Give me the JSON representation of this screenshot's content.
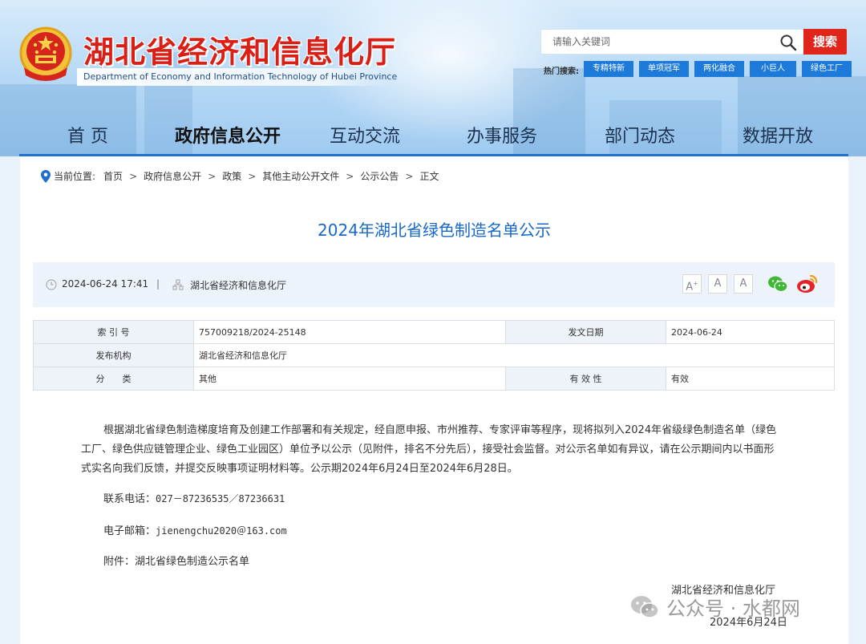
{
  "header": {
    "site_title": "湖北省经济和信息化厅",
    "site_subtitle": "Department of Economy and Information Technology of Hubei Province",
    "search": {
      "placeholder": "请输入关键词",
      "button_label": "搜索"
    },
    "hot_label": "热门搜索:",
    "hot_tags": [
      "专精特新",
      "单项冠军",
      "两化融合",
      "小巨人",
      "绿色工厂"
    ]
  },
  "nav": {
    "items": [
      "首 页",
      "政府信息公开",
      "互动交流",
      "办事服务",
      "部门动态",
      "数据开放"
    ],
    "active_index": 1
  },
  "breadcrumb": {
    "label": "当前位置:",
    "items": [
      "首页",
      "政府信息公开",
      "政策",
      "其他主动公开文件",
      "公示公告",
      "正文"
    ]
  },
  "article": {
    "title": "2024年湖北省绿色制造名单公示",
    "date": "2024-06-24 17:41",
    "divider": "|",
    "source": "湖北省经济和信息化厅",
    "font_sizes": [
      "A",
      "A",
      "A"
    ]
  },
  "info_table": {
    "rows": [
      {
        "k1": "索 引 号",
        "v1": "757009218/2024-25148",
        "k2": "发文日期",
        "v2": "2024-06-24"
      },
      {
        "k1": "发布机构",
        "v1": "湖北省经济和信息化厅"
      },
      {
        "k1": "分　　类",
        "v1": "其他",
        "k2": "有 效 性",
        "v2": "有效"
      }
    ]
  },
  "body": {
    "paragraph": "根据湖北省绿色制造梯度培育及创建工作部署和有关规定，经自愿申报、市州推荐、专家评审等程序，现将拟列入2024年省级绿色制造名单（绿色工厂、绿色供应链管理企业、绿色工业园区）单位予以公示（见附件，排名不分先后），接受社会监督。对公示名单如有异议，请在公示期间内以书面形式实名向我们反馈，并提交反映事项证明材料等。公示期2024年6月24日至2024年6月28日。",
    "phone_label": "联系电话：",
    "phone": "027－87236535／87236631",
    "email_label": "电子邮箱：",
    "email": "jienengchu2020＠163.com",
    "attachment_label": "附件：",
    "attachment": "湖北省绿色制造公示名单",
    "sign_org": "湖北省经济和信息化厅",
    "sign_date": "2024年6月24日"
  },
  "watermark": {
    "text": "公众号 · 水都网"
  },
  "colors": {
    "brand_red": "#d91f16",
    "nav_blue": "#1e6fd0",
    "title_blue": "#1868c8",
    "tag_blue": "#1e7ad8"
  }
}
